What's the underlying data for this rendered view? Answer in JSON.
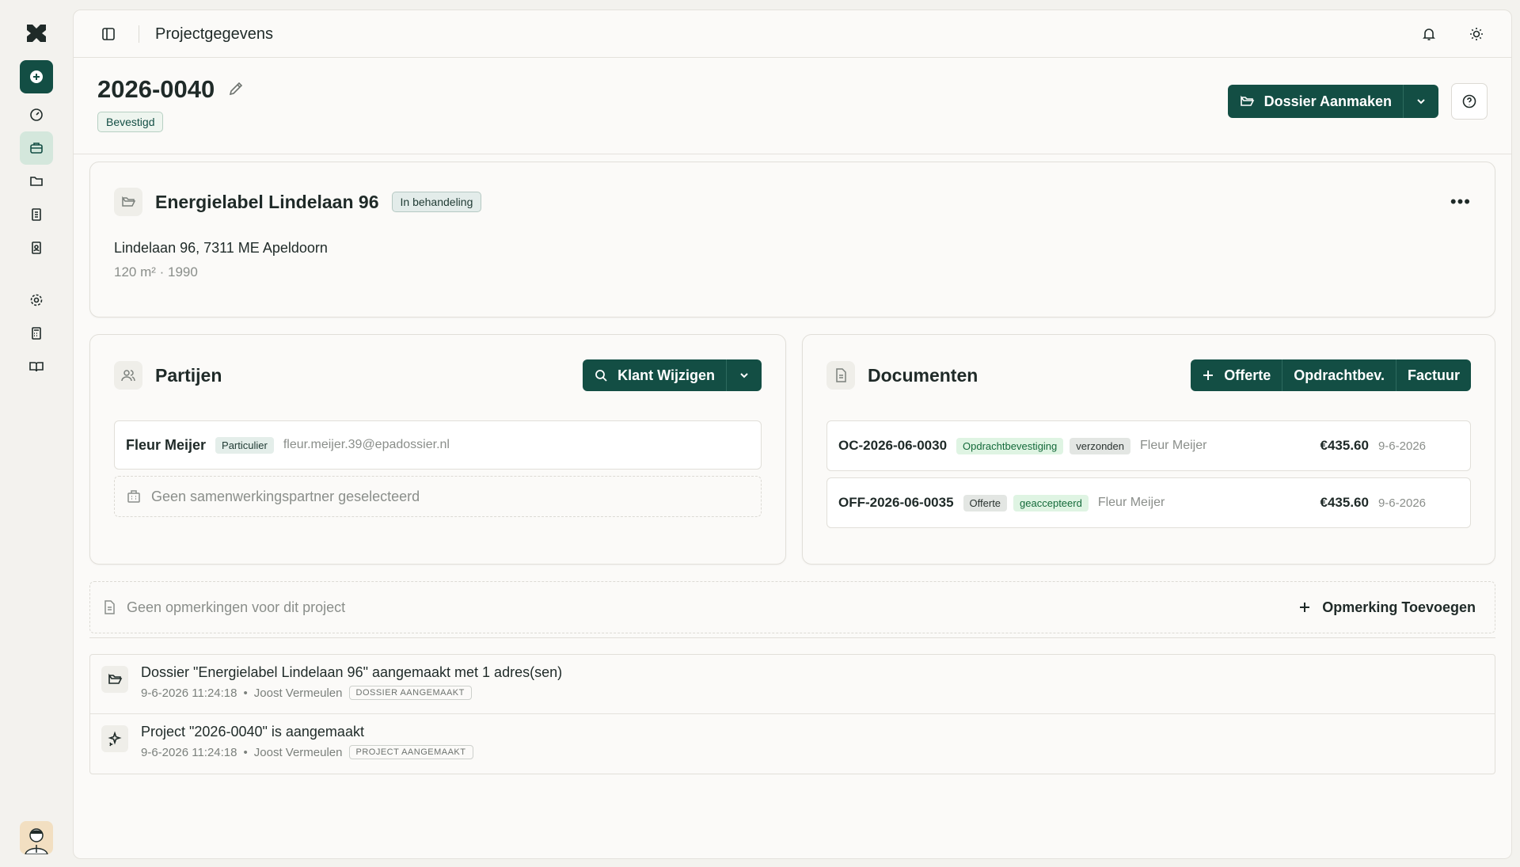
{
  "topbar": {
    "title": "Projectgegevens"
  },
  "project": {
    "number": "2026-0040",
    "status": "Bevestigd"
  },
  "actions": {
    "create_dossier": "Dossier Aanmaken"
  },
  "dossier": {
    "title": "Energielabel Lindelaan 96",
    "status": "In behandeling",
    "address": "Lindelaan 96, 7311 ME Apeldoorn",
    "details": "120 m² · 1990"
  },
  "parties": {
    "title": "Partijen",
    "change_client": "Klant Wijzigen",
    "client_name": "Fleur Meijer",
    "client_type": "Particulier",
    "client_email": "fleur.meijer.39@epadossier.nl",
    "no_partner": "Geen samenwerkingspartner geselecteerd"
  },
  "documents": {
    "title": "Documenten",
    "btn_quote": "Offerte",
    "btn_order": "Opdrachtbev.",
    "btn_invoice": "Factuur",
    "items": [
      {
        "code": "OC-2026-06-0030",
        "type": "Opdrachtbevestiging",
        "status": "verzonden",
        "client": "Fleur Meijer",
        "amount": "€435.60",
        "date": "9-6-2026"
      },
      {
        "code": "OFF-2026-06-0035",
        "type": "Offerte",
        "status": "geaccepteerd",
        "client": "Fleur Meijer",
        "amount": "€435.60",
        "date": "9-6-2026"
      }
    ]
  },
  "notes": {
    "empty": "Geen opmerkingen voor dit project",
    "add": "Opmerking Toevoegen"
  },
  "timeline": [
    {
      "title": "Dossier \"Energielabel Lindelaan 96\" aangemaakt met 1 adres(sen)",
      "time": "9-6-2026 11:24:18",
      "user": "Joost Vermeulen",
      "tag": "DOSSIER AANGEMAAKT"
    },
    {
      "title": "Project \"2026-0040\" is aangemaakt",
      "time": "9-6-2026 11:24:18",
      "user": "Joost Vermeulen",
      "tag": "PROJECT AANGEMAAKT"
    }
  ],
  "colors": {
    "brand": "#134e44",
    "accent_light": "#d4e7dc"
  }
}
